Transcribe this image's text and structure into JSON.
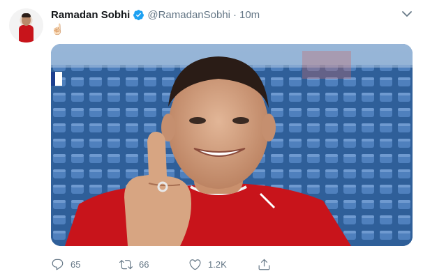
{
  "tweet": {
    "author_name": "Ramadan Sobhi",
    "handle": "@RamadanSobhi",
    "separator": "·",
    "time": "10m",
    "text": "☝🏻",
    "verified": true
  },
  "actions": {
    "replies": "65",
    "retweets": "66",
    "likes": "1.2K"
  },
  "colors": {
    "verified": "#1da1f2",
    "muted": "#657786",
    "jersey": "#c8141b"
  },
  "icons": [
    "verified-icon",
    "chevron-down-icon",
    "reply-icon",
    "retweet-icon",
    "like-icon",
    "share-icon"
  ]
}
